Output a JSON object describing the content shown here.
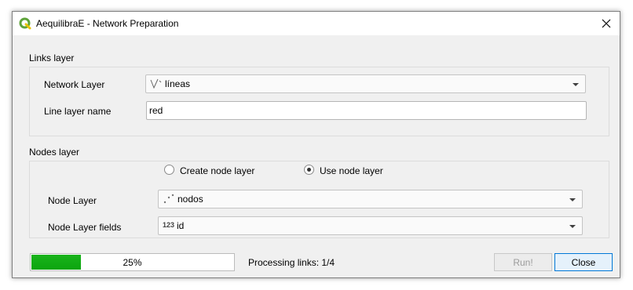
{
  "window": {
    "title": "AequilibraE - Network Preparation"
  },
  "links_section": {
    "label": "Links layer",
    "network_layer_label": "Network Layer",
    "network_layer_value": "líneas",
    "line_layer_name_label": "Line layer name",
    "line_layer_name_value": "red"
  },
  "nodes_section": {
    "label": "Nodes layer",
    "create_node_layer_label": "Create node layer",
    "use_node_layer_label": "Use node layer",
    "selected_option": "Use node layer",
    "node_layer_label": "Node Layer",
    "node_layer_value": "nodos",
    "node_layer_fields_label": "Node Layer fields",
    "node_layer_fields_type_icon": "123",
    "node_layer_fields_value": "id"
  },
  "footer": {
    "progress_percent": 25,
    "progress_text": "25%",
    "status": "Processing links: 1/4",
    "run_label": "Run!",
    "close_label": "Close"
  },
  "colors": {
    "progress_fill": "#0ca50f",
    "qgis_green": "#5ea33a",
    "default_button_border": "#0078d7"
  },
  "icons": {
    "app": "qgis-logo-icon",
    "close": "close-icon",
    "line_layer": "line-layer-icon",
    "point_layer": "point-layer-icon",
    "integer_field": "integer-field-icon",
    "dropdown": "chevron-down-icon"
  }
}
